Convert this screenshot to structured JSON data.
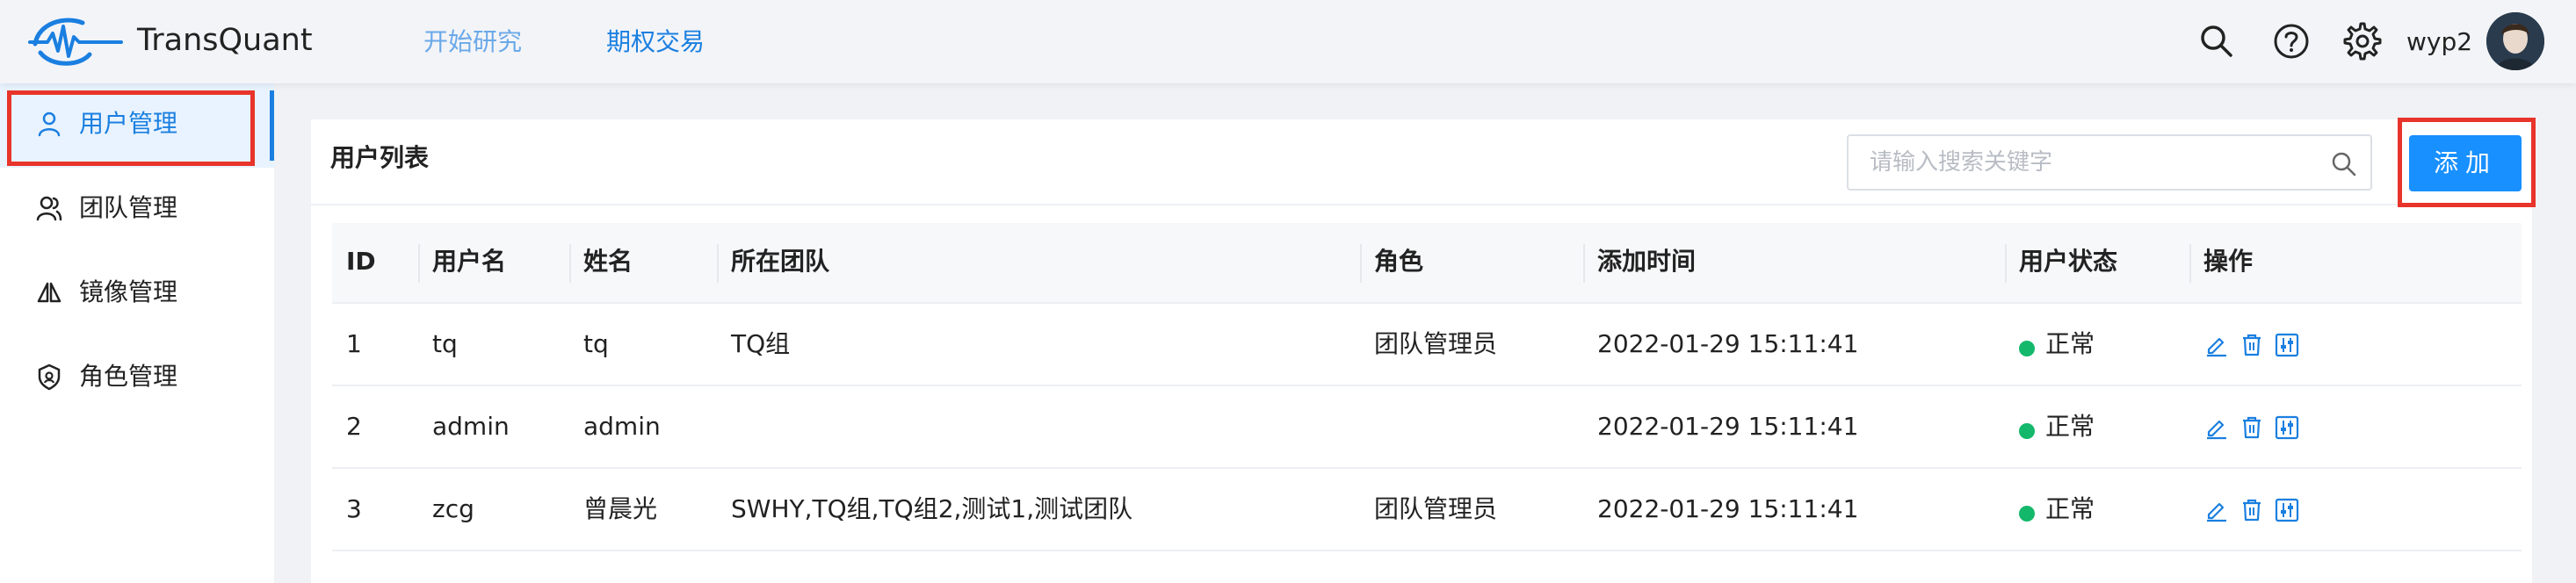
{
  "header": {
    "brand": "TransQuant",
    "nav": [
      "开始研究",
      "期权交易"
    ],
    "icons": [
      "search-icon",
      "help-icon",
      "gear-icon"
    ],
    "username": "wyp2"
  },
  "sidebar": {
    "items": [
      {
        "label": "用户管理",
        "icon": "user-icon",
        "active": true
      },
      {
        "label": "团队管理",
        "icon": "team-icon",
        "active": false
      },
      {
        "label": "镜像管理",
        "icon": "mirror-icon",
        "active": false
      },
      {
        "label": "角色管理",
        "icon": "shield-icon",
        "active": false
      }
    ]
  },
  "main": {
    "title": "用户列表",
    "search_placeholder": "请输入搜索关键字",
    "add_label": "添加",
    "columns": [
      "ID",
      "用户名",
      "姓名",
      "所在团队",
      "角色",
      "添加时间",
      "用户状态",
      "操作"
    ],
    "rows": [
      {
        "id": "1",
        "username": "tq",
        "name": "tq",
        "team": "TQ组",
        "role": "团队管理员",
        "time": "2022-01-29 15:11:41",
        "status": "正常"
      },
      {
        "id": "2",
        "username": "admin",
        "name": "admin",
        "team": "",
        "role": "",
        "time": "2022-01-29 15:11:41",
        "status": "正常"
      },
      {
        "id": "3",
        "username": "zcg",
        "name": "曾晨光",
        "team": "SWHY,TQ组,TQ组2,测试1,测试团队",
        "role": "团队管理员",
        "time": "2022-01-29 15:11:41",
        "status": "正常"
      }
    ]
  },
  "colors": {
    "accent": "#1890ff",
    "status_ok": "#14b86b",
    "highlight": "#e8342b"
  }
}
